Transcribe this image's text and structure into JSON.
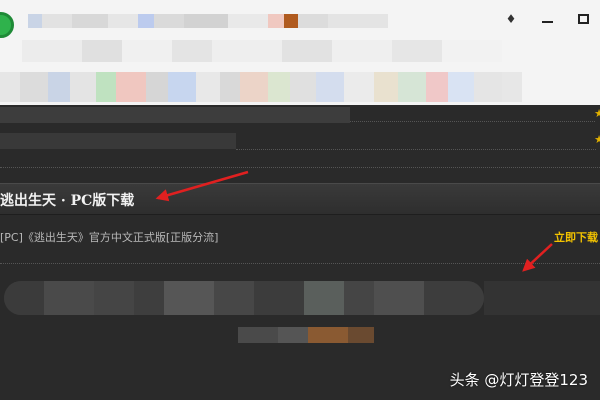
{
  "window": {
    "controls": [
      "shirt-icon",
      "minimize-icon",
      "maximize-icon"
    ]
  },
  "section": {
    "title": "逃出生天 · PC版下载"
  },
  "download": {
    "description": "[PC]《逃出生天》官方中文正式版[正版分流]",
    "link_label": "立即下载"
  },
  "watermark": {
    "text": "头条 @灯灯登登123"
  },
  "colors": {
    "page_bg": "#2a2a2a",
    "link": "#f2c200",
    "arrow": "#e02020"
  }
}
